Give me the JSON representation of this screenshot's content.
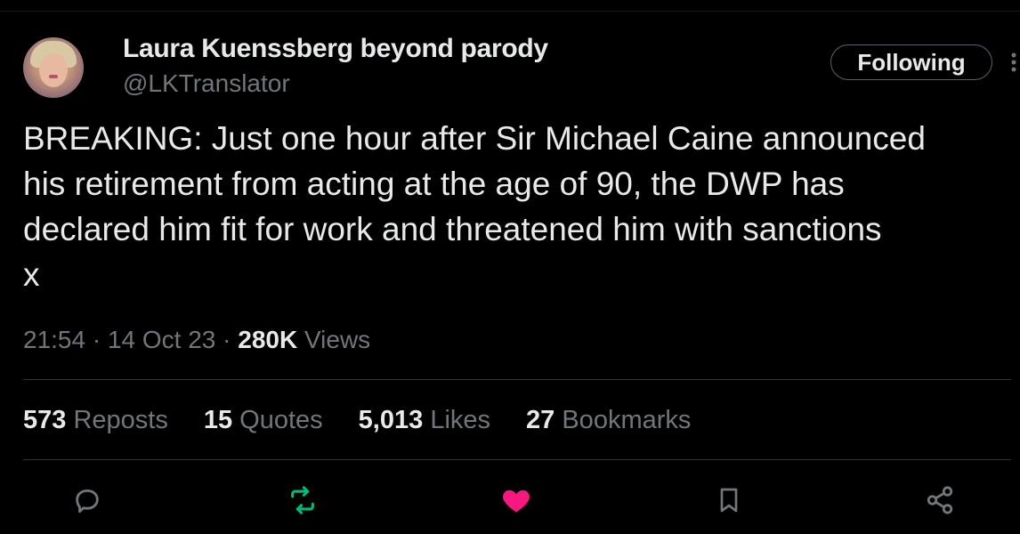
{
  "author": {
    "display_name": "Laura Kuenssberg beyond parody",
    "handle": "@LKTranslator"
  },
  "follow_button": {
    "label": "Following"
  },
  "tweet": {
    "text": "BREAKING: Just one hour after Sir Michael Caine announced\nhis retirement from acting at the age of 90, the DWP has\ndeclared him fit for work and threatened him with sanctions\nx"
  },
  "meta": {
    "time": "21:54",
    "sep1": " · ",
    "date": "14 Oct 23",
    "sep2": " · ",
    "views_count": "280K",
    "views_label": " Views"
  },
  "stats": [
    {
      "count": "573",
      "label": "Reposts"
    },
    {
      "count": "15",
      "label": "Quotes"
    },
    {
      "count": "5,013",
      "label": "Likes"
    },
    {
      "count": "27",
      "label": "Bookmarks"
    }
  ],
  "actions": {
    "reply_icon": "reply-icon",
    "repost_icon": "repost-icon",
    "like_icon": "like-icon",
    "bookmark_icon": "bookmark-icon",
    "share_icon": "share-icon"
  },
  "colors": {
    "background": "#000000",
    "text_primary": "#e7e9ea",
    "text_secondary": "#71767b",
    "divider": "#2f3336",
    "repost_active": "#00ba7c",
    "like_active": "#f91880"
  }
}
